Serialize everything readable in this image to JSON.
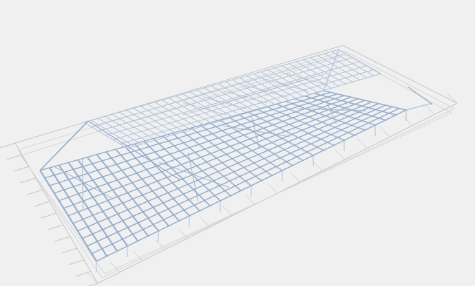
{
  "viewport": {
    "background_color": "#f0f0f0",
    "subject": "3d-structural-frame-wireframe",
    "colors": {
      "grid_line": "#c4c4c4",
      "grid_line_light": "#d6d6d6",
      "frame_member": "#8ea9cc",
      "frame_member_light": "#aec1da",
      "bracing": "#9fb3cc"
    }
  }
}
